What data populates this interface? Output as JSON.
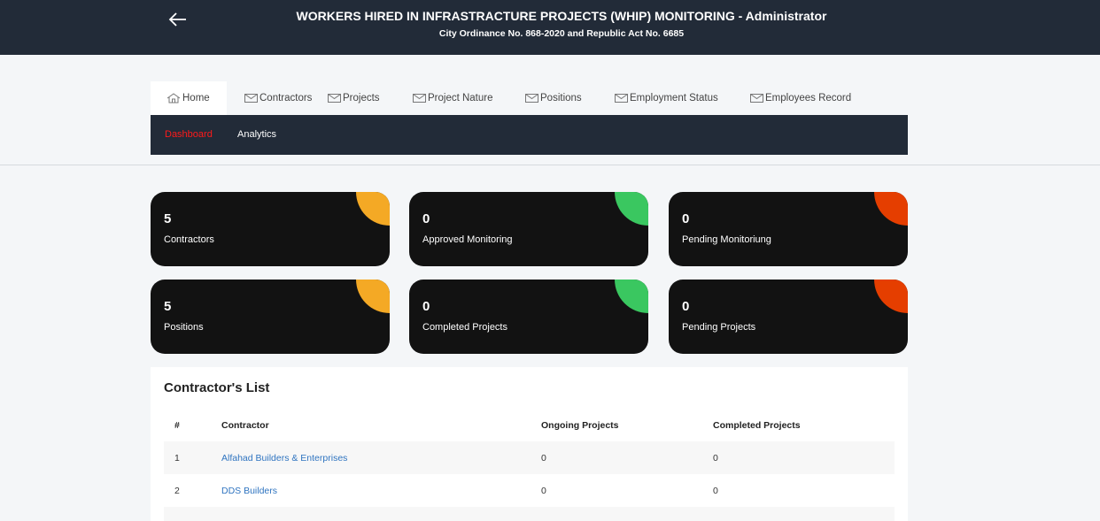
{
  "header": {
    "title": "WORKERS HIRED IN INFRASTRACTURE PROJECTS (WHIP) MONITORING - Administrator",
    "subtitle": "City Ordinance No. 868-2020 and Republic Act No. 6685",
    "back_icon": "arrow-left-icon"
  },
  "tabs": [
    {
      "label": "Home",
      "icon": "home-icon",
      "active": true
    },
    {
      "label": "Contractors",
      "icon": "envelope-icon"
    },
    {
      "label": "Projects",
      "icon": "envelope-icon"
    },
    {
      "label": "Project Nature",
      "icon": "envelope-icon"
    },
    {
      "label": "Positions",
      "icon": "envelope-icon"
    },
    {
      "label": "Employment Status",
      "icon": "envelope-icon"
    },
    {
      "label": "Employees Record",
      "icon": "envelope-icon"
    }
  ],
  "subnav": {
    "dashboard": "Dashboard",
    "analytics": "Analytics",
    "active_color": "#ff1a1a"
  },
  "cards": [
    {
      "value": "5",
      "label": "Contractors",
      "accent": "#f4a925"
    },
    {
      "value": "0",
      "label": "Approved Monitoring",
      "accent": "#3ac760"
    },
    {
      "value": "0",
      "label": "Pending Monitoriung",
      "accent": "#e53e00"
    },
    {
      "value": "5",
      "label": "Positions",
      "accent": "#f4a925"
    },
    {
      "value": "0",
      "label": "Completed Projects",
      "accent": "#3ac760"
    },
    {
      "value": "0",
      "label": "Pending Projects",
      "accent": "#e53e00"
    }
  ],
  "contractors_panel": {
    "title": "Contractor's List",
    "columns": [
      "#",
      "Contractor",
      "Ongoing Projects",
      "Completed Projects"
    ],
    "rows": [
      {
        "no": "1",
        "contractor": "Alfahad Builders & Enterprises",
        "ongoing": "0",
        "completed": "0"
      },
      {
        "no": "2",
        "contractor": "DDS Builders",
        "ongoing": "0",
        "completed": "0"
      }
    ]
  },
  "colors": {
    "header_bg": "#222b38",
    "card_bg": "#121212",
    "link": "#2f74c0"
  }
}
